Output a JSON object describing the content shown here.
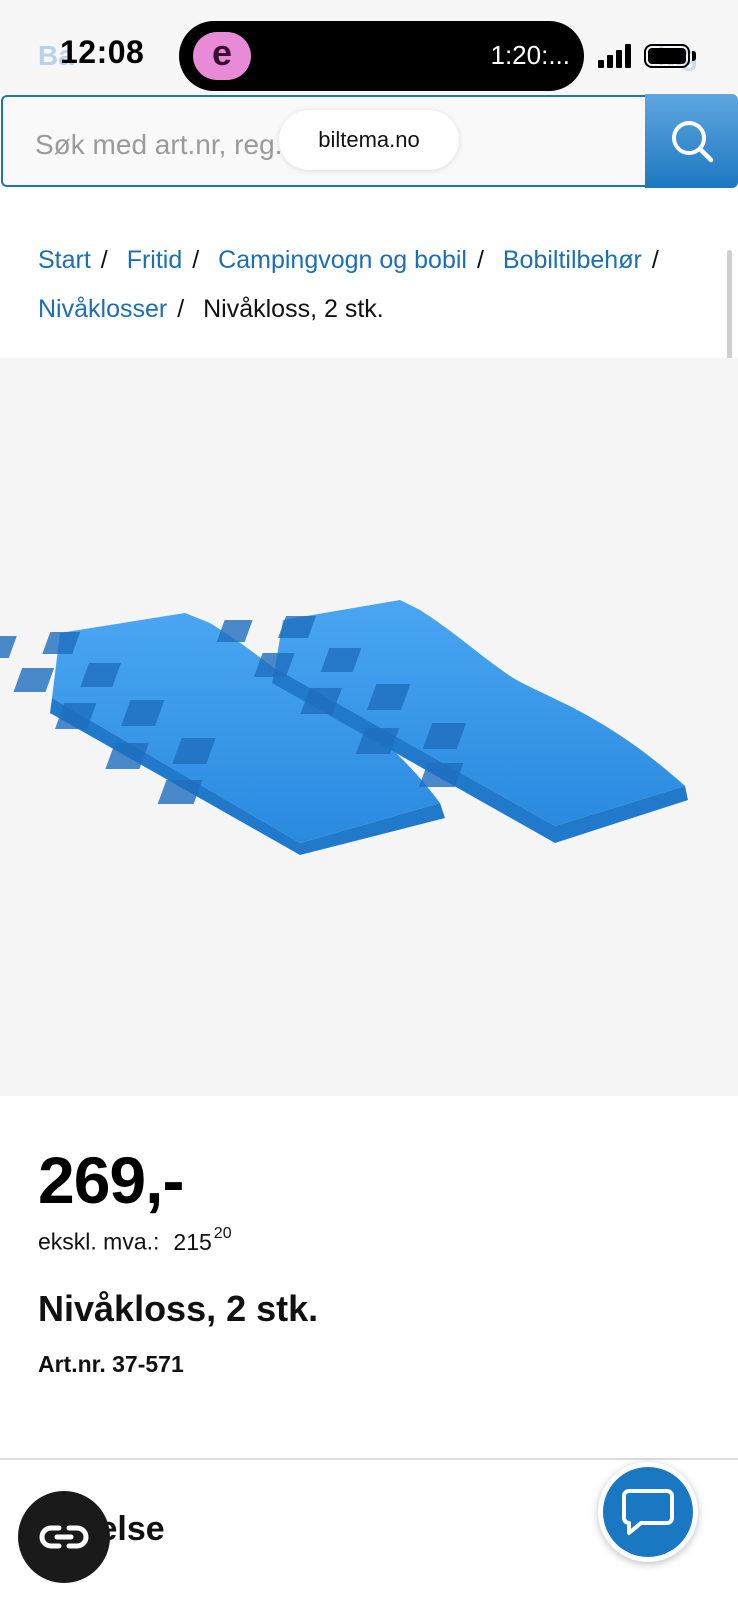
{
  "status_bar": {
    "time": "12:08",
    "timer": "1:20:...",
    "app_letter": "e",
    "ghost_left": "Ba",
    "ghost_right": "lag"
  },
  "browser": {
    "url": "biltema.no"
  },
  "search": {
    "placeholder": "Søk med art.nr, reg.nr"
  },
  "breadcrumb": {
    "items": [
      "Start",
      "Fritid",
      "Campingvogn og bobil",
      "Bobiltilbehør",
      "Nivåklosser"
    ],
    "current": "Nivåkloss, 2 stk."
  },
  "product": {
    "price": "269,-",
    "ex_vat_label": "ekskl. mva.:",
    "ex_vat_main": "215",
    "ex_vat_cents": "20",
    "title": "Nivåkloss, 2 stk.",
    "art_nr": "Art.nr. 37-571",
    "image_icon": "leveling-ramps-image",
    "product_color": "#2f8fe6"
  },
  "description": {
    "heading_visible": "krivelse"
  },
  "fabs": {
    "link_icon": "link-icon",
    "chat_icon": "chat-icon"
  },
  "colors": {
    "link": "#1b6fb3",
    "search_button": "#1d78c1",
    "chat_button": "#1a78c2"
  }
}
